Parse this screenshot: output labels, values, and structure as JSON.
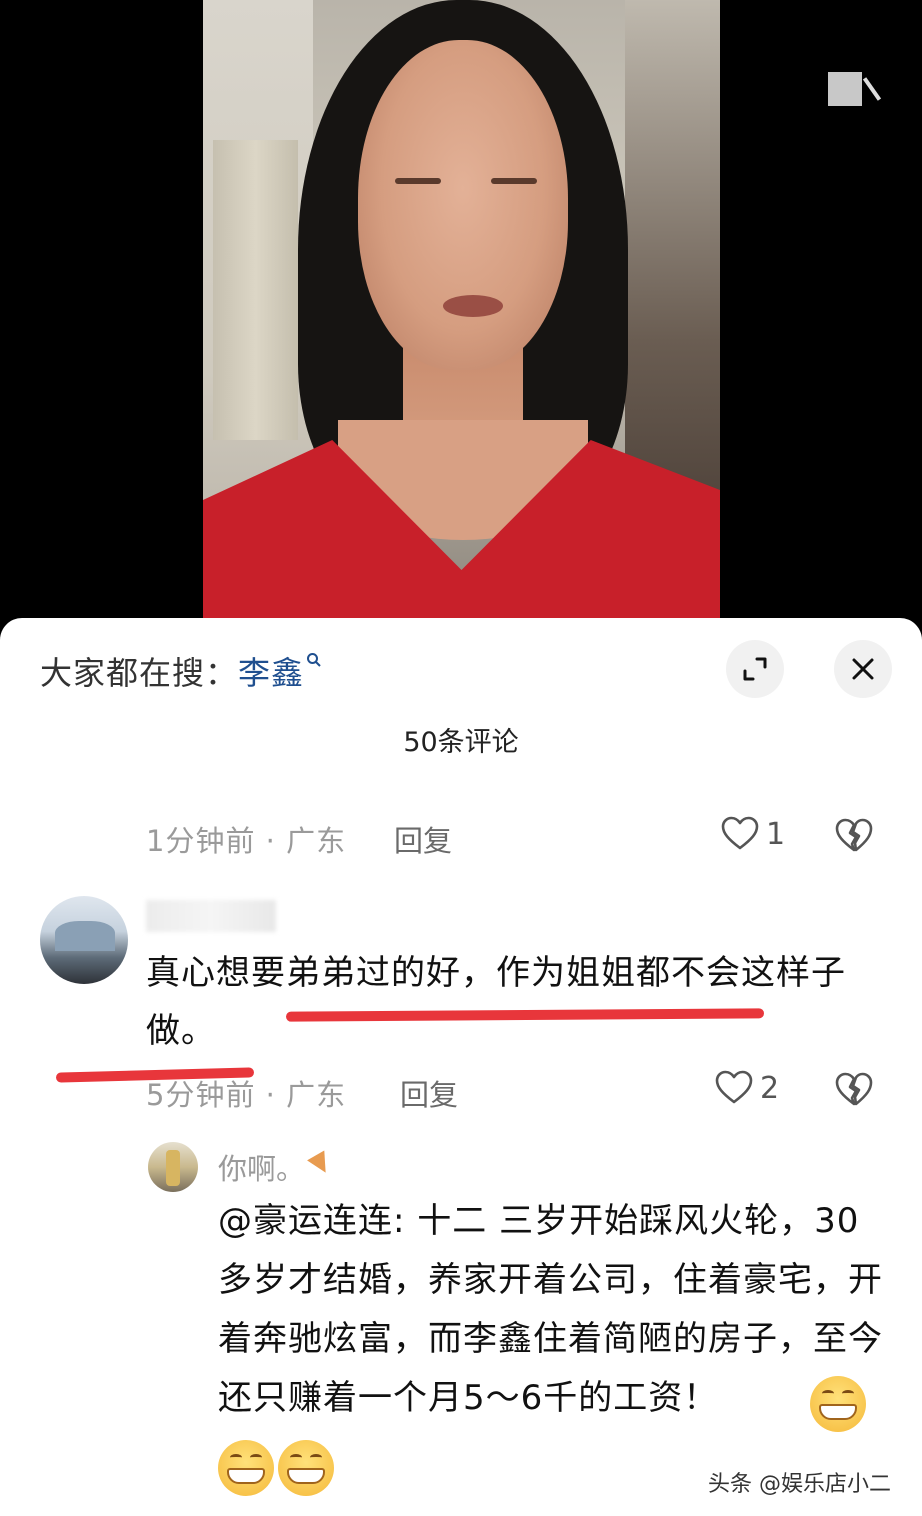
{
  "video": {
    "overlay_icon": "screen-mirror-icon"
  },
  "sheet": {
    "search_prefix": "大家都在搜：",
    "search_term": "李鑫",
    "search_icon": "magnifier-icon",
    "expand_icon": "expand-icon",
    "close_icon": "close-icon",
    "comment_count": "50条评论"
  },
  "comments": [
    {
      "time_location": "1分钟前 · 广东",
      "reply_label": "回复",
      "likes": "1"
    },
    {
      "text": "真心想要弟弟过的好，作为姐姐都不会这样子做。",
      "time_location": "5分钟前 · 广东",
      "reply_label": "回复",
      "likes": "2",
      "underline_color": "#e8363b"
    }
  ],
  "reply": {
    "username": "你啊。",
    "text": "@豪运连连: 十二  三岁开始踩风火轮，30多岁才结婚，养家开着公司，住着豪宅，开着奔驰炫富，而李鑫住着简陋的房子，至今还只赚着一个月5～6千的工资！",
    "emoji_icon": "grinning-face-icon",
    "emoji_count": 3
  },
  "watermark": "头条 @娱乐店小二"
}
